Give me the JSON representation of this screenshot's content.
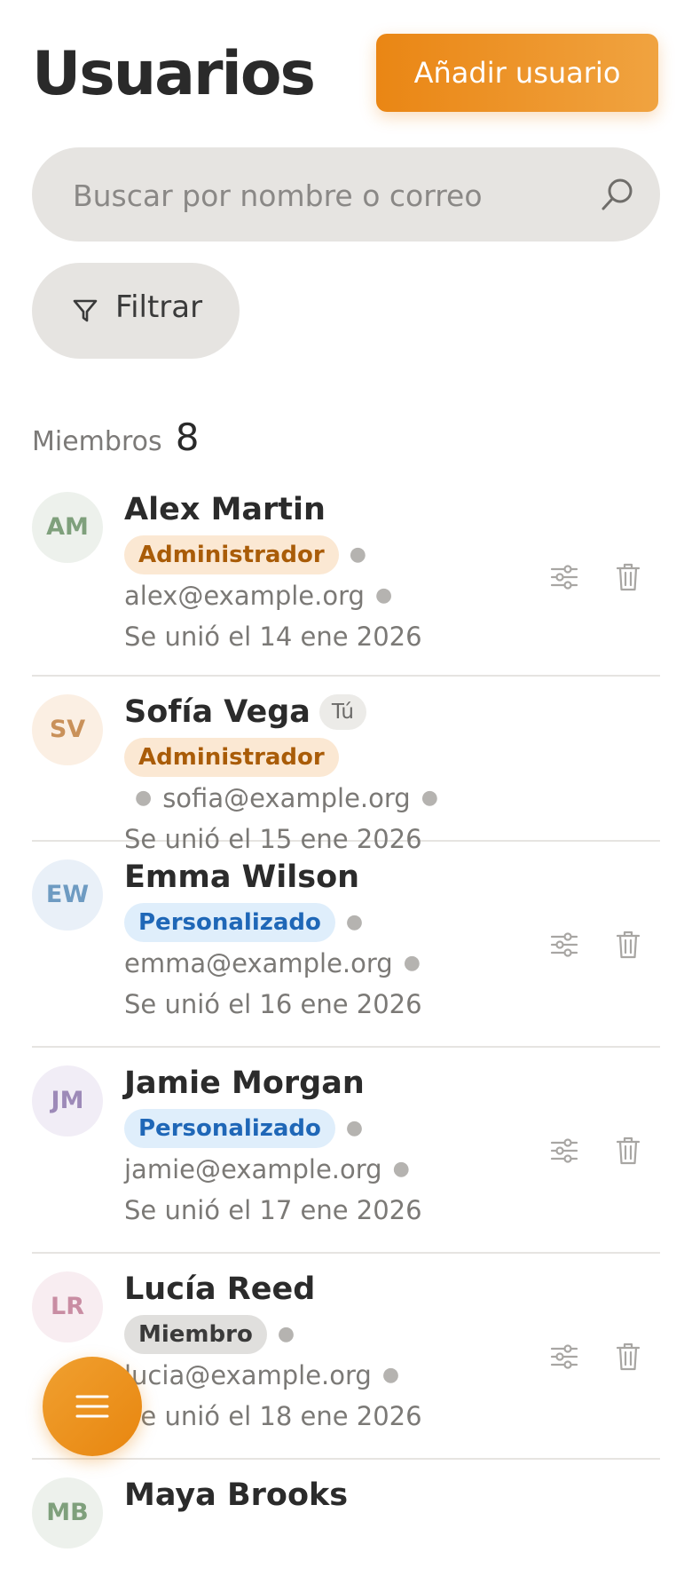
{
  "header": {
    "title": "Usuarios",
    "add_button": "Añadir usuario"
  },
  "search": {
    "placeholder": "Buscar por nombre o correo",
    "value": "",
    "icon": "search-icon"
  },
  "filter": {
    "label": "Filtrar",
    "icon": "filter-icon"
  },
  "members": {
    "label": "Miembros",
    "count": "8"
  },
  "colors": {
    "accent": "#ea8614",
    "admin_badge": "#fbe8d3",
    "custom_badge": "#dfeefb",
    "member_badge": "#e0dfdd"
  },
  "users": [
    {
      "initials": "AM",
      "name": "Alex Martin",
      "role": "Administrador",
      "email": "alex@example.org",
      "joined": "Se unió el 14 ene 2026",
      "you": ""
    },
    {
      "initials": "SV",
      "name": "Sofía Vega",
      "role": "Administrador",
      "email": "sofia@example.org",
      "joined": "Se unió el 15 ene 2026",
      "you": "Tú"
    },
    {
      "initials": "EW",
      "name": "Emma Wilson",
      "role": "Personalizado",
      "email": "emma@example.org",
      "joined": "Se unió el 16 ene 2026",
      "you": ""
    },
    {
      "initials": "JM",
      "name": "Jamie Morgan",
      "role": "Personalizado",
      "email": "jamie@example.org",
      "joined": "Se unió el 17 ene 2026",
      "you": ""
    },
    {
      "initials": "LR",
      "name": "Lucía Reed",
      "role": "Miembro",
      "email": "lucia@example.org",
      "joined": "Se unió el 18 ene 2026",
      "you": ""
    },
    {
      "initials": "MB",
      "name": "Maya Brooks"
    }
  ],
  "fab": {
    "icon": "menu-icon"
  }
}
